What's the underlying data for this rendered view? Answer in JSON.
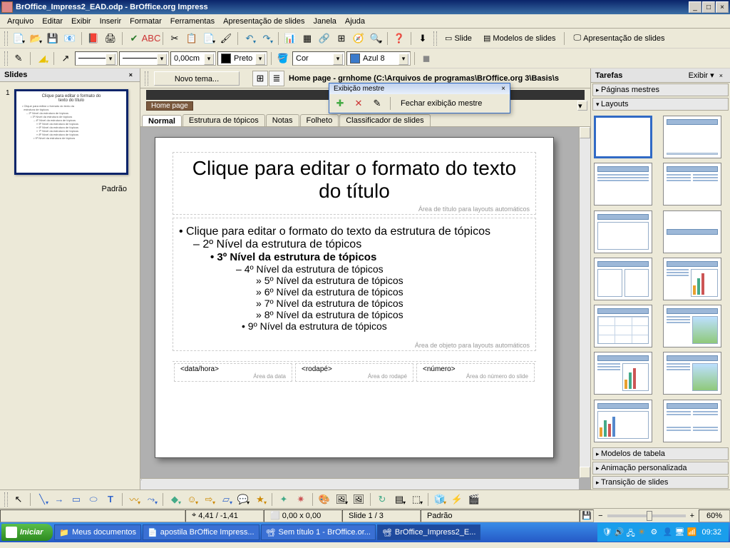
{
  "titlebar": {
    "text": "BrOffice_Impress2_EAD.odp - BrOffice.org Impress"
  },
  "menus": [
    "Arquivo",
    "Editar",
    "Exibir",
    "Inserir",
    "Formatar",
    "Ferramentas",
    "Apresentação de slides",
    "Janela",
    "Ajuda"
  ],
  "toolbar2": {
    "width_value": "0,00cm",
    "color1_label": "Preto",
    "fill_label": "Cor",
    "color2_label": "Azul 8"
  },
  "slide_button": "Slide",
  "masters_button": "Modelos de slides",
  "presentation_button": "Apresentação de slides",
  "slides_panel": {
    "title": "Slides",
    "slide_number": "1",
    "slide_name": "Padrão"
  },
  "center": {
    "novo_tema": "Novo tema...",
    "path": "Home page - grnhome (C:\\Arquivos de programas\\BrOffice.org 3\\Basis\\s",
    "brown_tab": "Home page",
    "master_window": {
      "title": "Exibição mestre",
      "close_label": "Fechar exibição mestre"
    },
    "tabs": [
      "Normal",
      "Estrutura de tópicos",
      "Notas",
      "Folheto",
      "Classificador de slides"
    ],
    "active_tab": 0
  },
  "slide": {
    "title": "Clique para editar o formato do texto do título",
    "title_hint": "Área de título para layouts automáticos",
    "lines": [
      {
        "lvl": "l1",
        "t": "Clique para editar o formato do texto da estrutura de tópicos"
      },
      {
        "lvl": "l2",
        "t": "2º Nível da estrutura de tópicos"
      },
      {
        "lvl": "l3",
        "t": "3º Nível da estrutura de tópicos"
      },
      {
        "lvl": "l4",
        "t": "4º Nível da estrutura de tópicos"
      },
      {
        "lvl": "l5",
        "t": "5º Nível da estrutura de tópicos"
      },
      {
        "lvl": "l5",
        "t": "6º Nível da estrutura de tópicos"
      },
      {
        "lvl": "l5",
        "t": "7º Nível da estrutura de tópicos"
      },
      {
        "lvl": "l5",
        "t": "8º Nível da estrutura de tópicos"
      },
      {
        "lvl": "l9",
        "t": "9º Nível da estrutura de tópicos"
      }
    ],
    "object_hint": "Área de objeto para layouts automáticos",
    "ph_date": "<data/hora>",
    "ph_date_hint": "Área da data",
    "ph_footer": "<rodapé>",
    "ph_footer_hint": "Área do rodapé",
    "ph_num": "<número>",
    "ph_num_hint": "Área do número do slide"
  },
  "tasks": {
    "title": "Tarefas",
    "view_label": "Exibir",
    "sections": [
      "Páginas mestres",
      "Layouts",
      "Modelos de tabela",
      "Animação personalizada",
      "Transição de slides"
    ]
  },
  "status": {
    "pos": "4,41 / -1,41",
    "size": "0,00 x 0,00",
    "slide": "Slide 1 / 3",
    "master": "Padrão",
    "zoom": "60%"
  },
  "taskbar": {
    "start": "Iniciar",
    "items": [
      "Meus documentos",
      "apostila BrOffice Impress...",
      "Sem título 1 - BrOffice.or...",
      "BrOffice_Impress2_E..."
    ],
    "active_index": 3,
    "clock": "09:32"
  }
}
